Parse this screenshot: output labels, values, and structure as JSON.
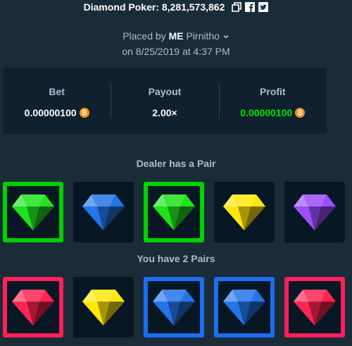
{
  "header": {
    "title": "Diamond Poker: 8,281,573,862"
  },
  "meta": {
    "placed_by_prefix": "Placed by",
    "username_badge": "ME",
    "username": "Pirnitho",
    "date_line": "on 8/25/2019 at 4:37 PM"
  },
  "stats": {
    "bet_label": "Bet",
    "bet_value": "0.00000100",
    "payout_label": "Payout",
    "payout_value": "2.00×",
    "profit_label": "Profit",
    "profit_value": "0.00000100"
  },
  "dealer": {
    "label": "Dealer has a Pair",
    "gems": [
      {
        "gem": "green",
        "highlight": "#00d100"
      },
      {
        "gem": "blue",
        "highlight": null
      },
      {
        "gem": "green",
        "highlight": "#00d100"
      },
      {
        "gem": "yellow",
        "highlight": null
      },
      {
        "gem": "purple",
        "highlight": null
      }
    ]
  },
  "player": {
    "label": "You have 2 Pairs",
    "gems": [
      {
        "gem": "red",
        "highlight": "#ff1f5a"
      },
      {
        "gem": "yellow",
        "highlight": null
      },
      {
        "gem": "blue",
        "highlight": "#1c6ef0"
      },
      {
        "gem": "blue",
        "highlight": "#1c6ef0"
      },
      {
        "gem": "red",
        "highlight": "#ff1f5a"
      }
    ]
  },
  "colors": {
    "background": "#1a2c38",
    "panel": "#0f212e",
    "profit_green": "#00e701",
    "btc_orange": "#f7931a",
    "gem_green": "#1fe31a",
    "gem_blue": "#2475e8",
    "gem_yellow": "#ffe70a",
    "gem_purple": "#9b4dff",
    "gem_red": "#ff2453"
  },
  "icons": {
    "copy": "copy-icon",
    "facebook": "facebook-icon",
    "twitter": "twitter-icon",
    "bitcoin": "bitcoin-icon",
    "chevron": "chevron-down-icon"
  }
}
